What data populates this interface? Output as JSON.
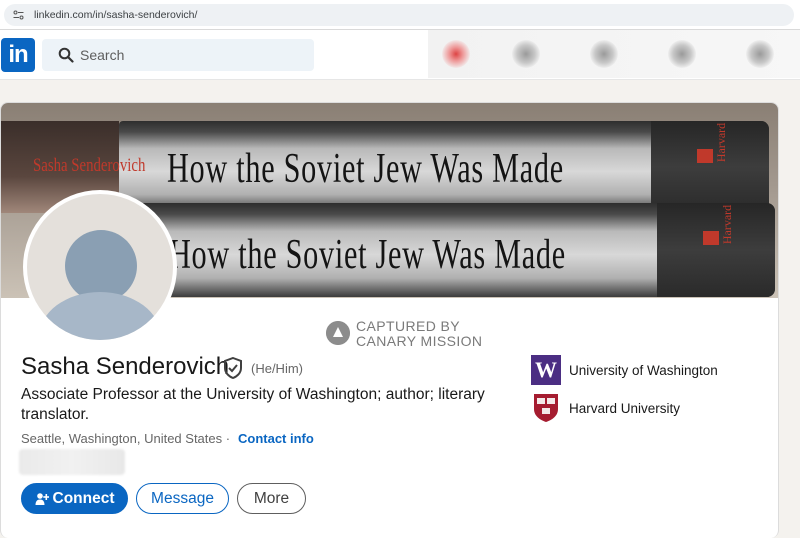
{
  "browser": {
    "url": "linkedin.com/in/sasha-senderovich/"
  },
  "nav": {
    "logo_text": "in",
    "search_placeholder": "Search"
  },
  "banner": {
    "book_title": "How the Soviet Jew Was Made",
    "book_author": "Sasha Senderovich",
    "publisher": "Harvard"
  },
  "watermark": {
    "line1": "CAPTURED BY",
    "line2": "CANARY MISSION"
  },
  "profile": {
    "name": "Sasha Senderovich",
    "pronouns": "(He/Him)",
    "headline": "Associate Professor at the University of Washington; author; literary translator.",
    "location": "Seattle, Washington, United States",
    "separator": "·",
    "contact_info": "Contact info"
  },
  "actions": {
    "connect": "Connect",
    "message": "Message",
    "more": "More"
  },
  "education": [
    {
      "name": "University of Washington",
      "logo_letter": "W",
      "color": "#4b2e83"
    },
    {
      "name": "Harvard University",
      "color": "#a51c30"
    }
  ],
  "colors": {
    "brand": "#0a66c2",
    "text": "#191919",
    "muted": "#666666"
  },
  "icons": [
    "site-info-icon",
    "search-icon",
    "verified-shield-icon",
    "add-person-icon",
    "canary-mission-icon"
  ]
}
